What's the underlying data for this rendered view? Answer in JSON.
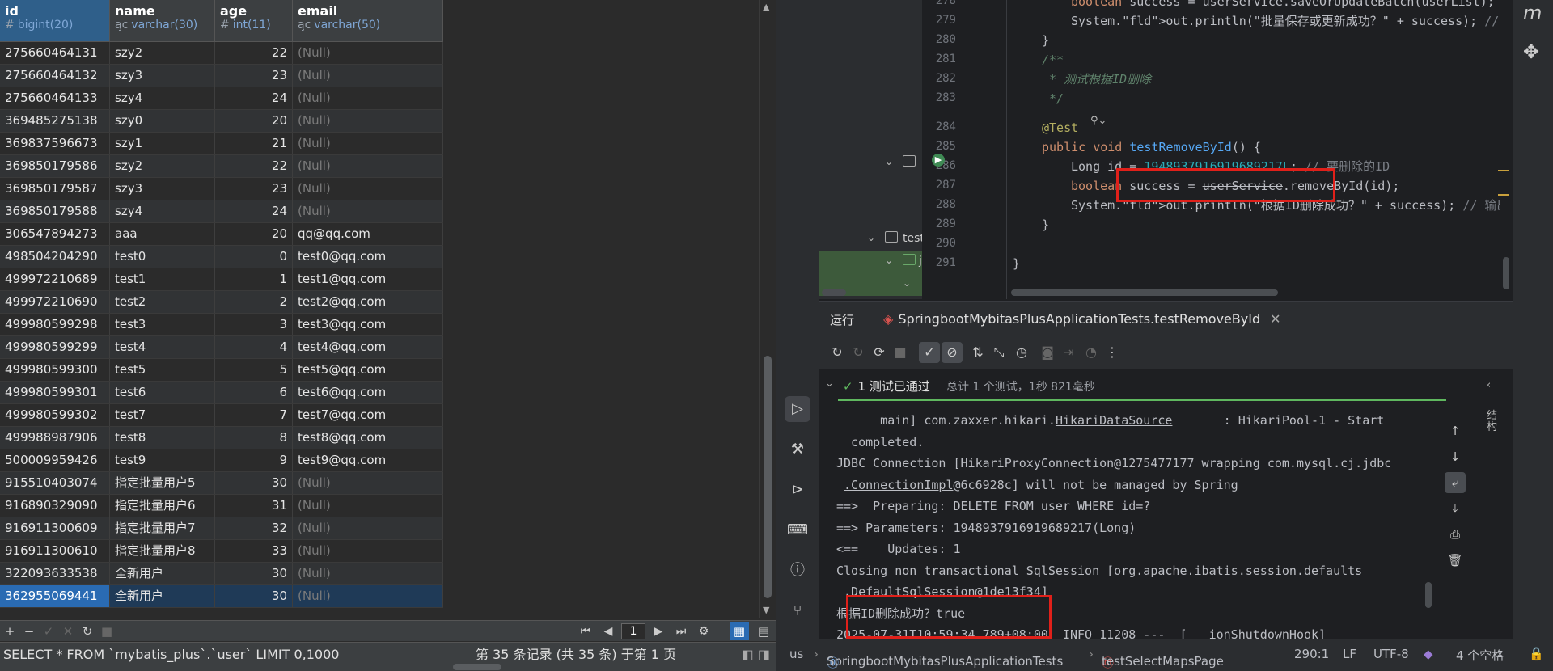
{
  "db": {
    "columns": [
      {
        "name": "id",
        "type": "bigint(20)",
        "icon": "#"
      },
      {
        "name": "name",
        "type": "varchar(30)",
        "icon": "a̧c"
      },
      {
        "name": "age",
        "type": "int(11)",
        "icon": "#"
      },
      {
        "name": "email",
        "type": "varchar(50)",
        "icon": "a̧c"
      }
    ],
    "rows": [
      {
        "id": "275660464131",
        "name": "szy2",
        "age": "22",
        "email": "(Null)"
      },
      {
        "id": "275660464132",
        "name": "szy3",
        "age": "23",
        "email": "(Null)"
      },
      {
        "id": "275660464133",
        "name": "szy4",
        "age": "24",
        "email": "(Null)"
      },
      {
        "id": "369485275138",
        "name": "szy0",
        "age": "20",
        "email": "(Null)"
      },
      {
        "id": "369837596673",
        "name": "szy1",
        "age": "21",
        "email": "(Null)"
      },
      {
        "id": "369850179586",
        "name": "szy2",
        "age": "22",
        "email": "(Null)"
      },
      {
        "id": "369850179587",
        "name": "szy3",
        "age": "23",
        "email": "(Null)"
      },
      {
        "id": "369850179588",
        "name": "szy4",
        "age": "24",
        "email": "(Null)"
      },
      {
        "id": "306547894273",
        "name": "aaa",
        "age": "20",
        "email": "qq@qq.com"
      },
      {
        "id": "498504204290",
        "name": "test0",
        "age": "0",
        "email": "test0@qq.com"
      },
      {
        "id": "499972210689",
        "name": "test1",
        "age": "1",
        "email": "test1@qq.com"
      },
      {
        "id": "499972210690",
        "name": "test2",
        "age": "2",
        "email": "test2@qq.com"
      },
      {
        "id": "499980599298",
        "name": "test3",
        "age": "3",
        "email": "test3@qq.com"
      },
      {
        "id": "499980599299",
        "name": "test4",
        "age": "4",
        "email": "test4@qq.com"
      },
      {
        "id": "499980599300",
        "name": "test5",
        "age": "5",
        "email": "test5@qq.com"
      },
      {
        "id": "499980599301",
        "name": "test6",
        "age": "6",
        "email": "test6@qq.com"
      },
      {
        "id": "499980599302",
        "name": "test7",
        "age": "7",
        "email": "test7@qq.com"
      },
      {
        "id": "499988987906",
        "name": "test8",
        "age": "8",
        "email": "test8@qq.com"
      },
      {
        "id": "500009959426",
        "name": "test9",
        "age": "9",
        "email": "test9@qq.com"
      },
      {
        "id": "915510403074",
        "name": "指定批量用户5",
        "age": "30",
        "email": "(Null)"
      },
      {
        "id": "916890329090",
        "name": "指定批量用户6",
        "age": "31",
        "email": "(Null)"
      },
      {
        "id": "916911300609",
        "name": "指定批量用户7",
        "age": "32",
        "email": "(Null)"
      },
      {
        "id": "916911300610",
        "name": "指定批量用户8",
        "age": "33",
        "email": "(Null)"
      },
      {
        "id": "322093633538",
        "name": "全新用户",
        "age": "30",
        "email": "(Null)"
      },
      {
        "id": "362955069441",
        "name": "全新用户",
        "age": "30",
        "email": "(Null)"
      }
    ],
    "page_number": "1",
    "sql": "SELECT * FROM `mybatis_plus`.`user` LIMIT 0,1000",
    "record_info": "第 35 条记录 (共 35 条) 于第 1 页"
  },
  "project_tree": {
    "test_label": "test",
    "j_label": "j"
  },
  "code": {
    "lines": [
      {
        "n": "279",
        "t": "System.out.println(\"批量保存或更新成功？\" + success); // 输出: tru"
      },
      {
        "n": "280",
        "t": "}"
      },
      {
        "n": "281",
        "t": "/**"
      },
      {
        "n": "282",
        "t": " * 测试根据ID删除"
      },
      {
        "n": "283",
        "t": " */"
      },
      {
        "n": "284",
        "t": "@Test"
      },
      {
        "n": "285",
        "t": "public void testRemoveById() {"
      },
      {
        "n": "286",
        "t": "Long id = 1948937916919689217L; // 要删除的ID"
      },
      {
        "n": "287",
        "t": "boolean success = userService.removeById(id);"
      },
      {
        "n": "288",
        "t": "System.out.println(\"根据ID删除成功？\" + success); // 输出: true ("
      },
      {
        "n": "289",
        "t": "}"
      },
      {
        "n": "290",
        "t": ""
      },
      {
        "n": "291",
        "t": "}"
      }
    ],
    "top_partial": "boolean success = userService.saveOrUpdateBatch(userList);",
    "top_partial_ln": "278"
  },
  "run": {
    "panel_label": "运行",
    "tab_title": "SpringbootMybitasPlusApplicationTests.testRemoveById",
    "passed": "1 测试已通过",
    "total": "总计 1 个测试，1秒 821毫秒",
    "console": [
      "      main] com.zaxxer.hikari.HikariDataSource       : HikariPool-1 - Start",
      "  completed.",
      "JDBC Connection [HikariProxyConnection@1275477177 wrapping com.mysql.cj.jdbc",
      " .ConnectionImpl@6c6928c] will not be managed by Spring",
      "==>  Preparing: DELETE FROM user WHERE id=?",
      "==> Parameters: 1948937916919689217(Long)",
      "<==    Updates: 1",
      "Closing non transactional SqlSession [org.apache.ibatis.session.defaults",
      " .DefaultSqlSession@1de13f34]",
      "根据ID删除成功？true",
      "2025-07-31T10:59:34.789+08:00  INFO 11208 ---  [   ionShutdownHook]"
    ],
    "side_label": "结构"
  },
  "status": {
    "crumb1": "us",
    "crumb2": "SpringbootMybitasPlusApplicationTests",
    "crumb3": "testSelectMapsPage",
    "position": "290:1",
    "line_sep": "LF",
    "encoding": "UTF-8",
    "indent": "4 个空格"
  }
}
